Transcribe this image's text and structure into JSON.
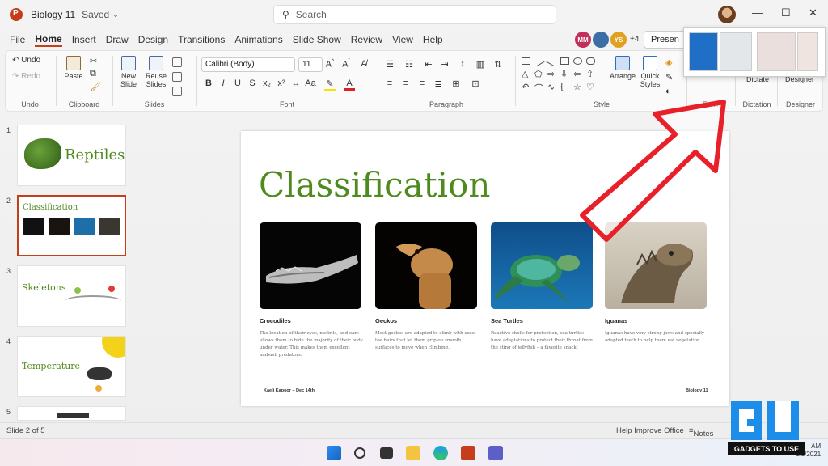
{
  "titlebar": {
    "doc_title": "Biology 11",
    "saved": "Saved",
    "search_placeholder": "Search"
  },
  "menu": {
    "tabs": [
      "File",
      "Home",
      "Insert",
      "Draw",
      "Design",
      "Transitions",
      "Animations",
      "Slide Show",
      "Review",
      "View",
      "Help"
    ]
  },
  "collaborators": {
    "c1": "MM",
    "c2": "YS",
    "more": "+4",
    "present": "Presen"
  },
  "ribbon": {
    "undo": "Undo",
    "redo": "Redo",
    "undo_group": "Undo",
    "paste": "Paste",
    "clipboard_group": "Clipboard",
    "new_slide": "New Slide",
    "reuse_slides": "Reuse Slides",
    "slides_group": "Slides",
    "font_name": "Calibri (Body)",
    "font_size": "11",
    "font_group": "Font",
    "paragraph_group": "Paragraph",
    "arrange": "Arrange",
    "quick_styles": "Quick Styles",
    "style_group": "Style",
    "editing_group": "Editin",
    "dictate": "Dictate",
    "dictation_group": "Dictation",
    "designer": "Designer",
    "designer_group": "Designer"
  },
  "slides": [
    {
      "num": "1",
      "title": "Reptiles"
    },
    {
      "num": "2",
      "title": "Classification"
    },
    {
      "num": "3",
      "title": "Skeletons"
    },
    {
      "num": "4",
      "title": "Temperature"
    },
    {
      "num": "5",
      "title": ""
    }
  ],
  "main_slide": {
    "title": "Classification",
    "cards": [
      {
        "caption": "Crocodiles",
        "body": "The location of their eyes, nostrils, and ears allows them to hide the majority of their body under water. This makes them excellent ambush predators."
      },
      {
        "caption": "Geckos",
        "body": "Most geckos are adapted to climb with ease, toe hairs that let them grip on smooth surfaces to move when climbing."
      },
      {
        "caption": "Sea Turtles",
        "body": "Reactive shells for protection, sea turtles have adaptations to protect their throat from the sting of jellyfish – a favorite snack!"
      },
      {
        "caption": "Iguanas",
        "body": "Iguanas have very strong jaws and specially adapted teeth to help them eat vegetation."
      }
    ],
    "footer_left": "Kaeli Kapoor – Dec 14th",
    "footer_right": "Biology 11"
  },
  "statusbar": {
    "slide_info": "Slide 2 of 5",
    "help": "Help Improve Office",
    "notes": "Notes"
  },
  "taskbar": {
    "time": "AM",
    "date": "1/1/2021"
  },
  "watermark": {
    "text": "GADGETS TO USE"
  },
  "colors": {
    "accent": "#c43e1c",
    "title_green": "#4f8a1e",
    "arrow_red": "#e8202a"
  }
}
